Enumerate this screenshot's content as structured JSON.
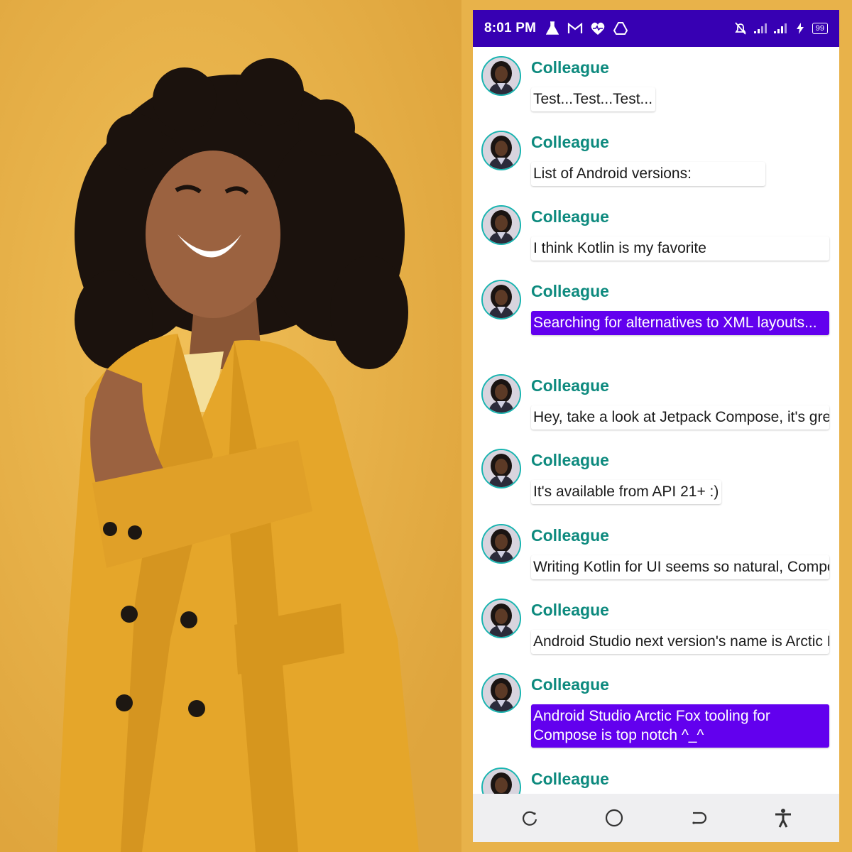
{
  "status_bar": {
    "time": "8:01 PM",
    "battery": "99",
    "left_icons": [
      "flask-icon",
      "gmail-icon",
      "heart-icon",
      "drive-icon"
    ],
    "right_icons": [
      "notifications-off-icon",
      "signal-icon",
      "signal-icon",
      "charging-icon"
    ]
  },
  "messages": [
    {
      "author": "Colleague",
      "body": "Test...Test...Test...",
      "expanded": false
    },
    {
      "author": "Colleague",
      "body": "List of Android versions:",
      "expanded": false
    },
    {
      "author": "Colleague",
      "body": "I think Kotlin is my favorite",
      "expanded": false
    },
    {
      "author": "Colleague",
      "body": "Searching for alternatives to XML layouts...",
      "expanded": true
    },
    {
      "author": "Colleague",
      "body": "Hey, take a look at Jetpack Compose, it's great!",
      "expanded": false
    },
    {
      "author": "Colleague",
      "body": "It's available from API 21+ :)",
      "expanded": false
    },
    {
      "author": "Colleague",
      "body": "Writing Kotlin for UI seems so natural, Compose where have you been all my life?",
      "expanded": false
    },
    {
      "author": "Colleague",
      "body": "Android Studio next version's name is Arctic Fox",
      "expanded": false
    },
    {
      "author": "Colleague",
      "body": "Android Studio Arctic Fox tooling for Compose is top notch ^_^",
      "expanded": true
    },
    {
      "author": "Colleague",
      "body": "",
      "expanded": false
    }
  ],
  "colors": {
    "status_bar": "#3700b3",
    "author": "#0d8a7e",
    "expanded_bubble": "#6200ee",
    "background": "#e8b24a"
  },
  "nav_bar": [
    "rotate-icon",
    "home-icon",
    "back-icon",
    "accessibility-icon"
  ]
}
